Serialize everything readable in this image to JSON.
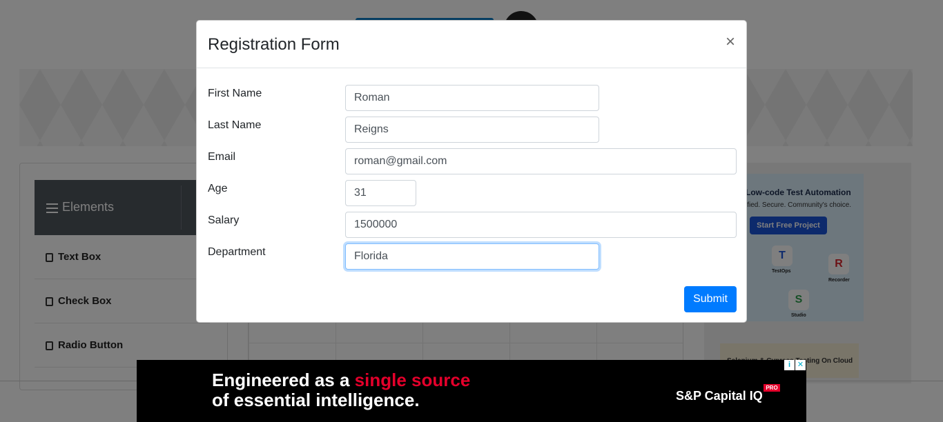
{
  "background": {
    "sidebar": {
      "header": "Elements",
      "items": [
        {
          "label": "Text Box"
        },
        {
          "label": "Check Box"
        },
        {
          "label": "Radio Button"
        }
      ]
    },
    "side_ad": {
      "title": "Low-code Test Automation",
      "subtitle": "ified. Secure. Community's choice.",
      "button": "Start Free Project",
      "products": [
        "TestOps",
        "Recorder",
        "Studio"
      ],
      "secondary": "Selenium & Cypress Testing On Cloud"
    }
  },
  "modal": {
    "title": "Registration Form",
    "close_glyph": "×",
    "fields": {
      "first_name": {
        "label": "First Name",
        "value": "Roman"
      },
      "last_name": {
        "label": "Last Name",
        "value": "Reigns"
      },
      "email": {
        "label": "Email",
        "value": "roman@gmail.com"
      },
      "age": {
        "label": "Age",
        "value": "31"
      },
      "salary": {
        "label": "Salary",
        "value": "1500000"
      },
      "department": {
        "label": "Department",
        "value": "Florida"
      }
    },
    "submit_label": "Submit"
  },
  "bottom_ad": {
    "line1_prefix": "Engineered as a ",
    "line1_highlight": "single source",
    "line2": "of essential intelligence.",
    "brand": "S&P Capital IQ",
    "brand_badge": "PRO",
    "info_glyph": "i",
    "close_glyph": "✕"
  },
  "colors": {
    "accent": "#007bff",
    "focus_border": "#80bdff",
    "ad_highlight": "#e4002b",
    "sidebar_header": "#4f565d"
  }
}
